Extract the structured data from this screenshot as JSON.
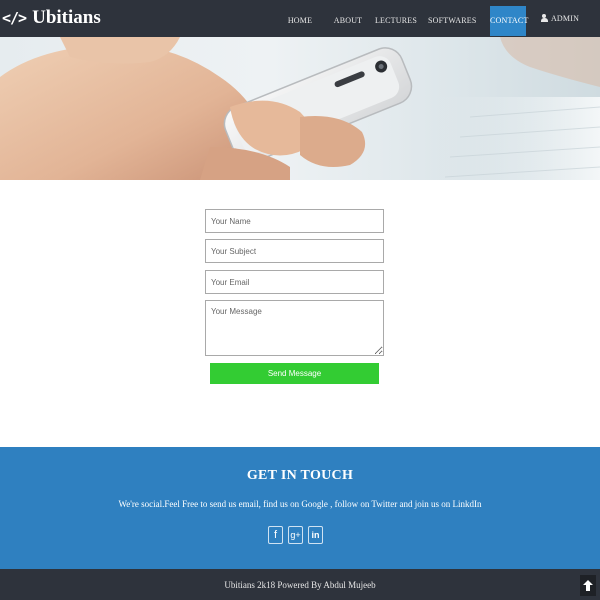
{
  "brand": {
    "icon": "</>",
    "name": "Ubitians"
  },
  "nav": {
    "items": [
      {
        "label": "HOME"
      },
      {
        "label": "ABOUT"
      },
      {
        "label": "LECTURES"
      },
      {
        "label": "SOFTWARES"
      },
      {
        "label": "CONTACT",
        "active": true
      },
      {
        "label": "ADMIN",
        "icon": "user-icon"
      }
    ]
  },
  "hero": {
    "image": "hand holding smartphone near laptop keyboard"
  },
  "form": {
    "name_placeholder": "Your Name",
    "subject_placeholder": "Your Subject",
    "email_placeholder": "Your Email",
    "message_placeholder": "Your Message",
    "send_label": "Send Message"
  },
  "touch": {
    "title": "GET IN TOUCH",
    "text": "We're social.Feel Free to send us email, find us on Google , follow on Twitter and join us on LinkdIn",
    "socials": [
      {
        "icon": "facebook-icon",
        "glyph": "f"
      },
      {
        "icon": "google-plus-icon",
        "glyph": "g+"
      },
      {
        "icon": "linkedin-icon",
        "glyph": "in"
      }
    ]
  },
  "footer": {
    "text": "Ubitians 2k18 Powered By Abdul Mujeeb",
    "top_icon": "arrow-up-icon"
  },
  "colors": {
    "navbar": "#2e333c",
    "active_nav": "#2f86c8",
    "send_button": "#33cc33",
    "contact_section": "#2f80c0",
    "footer": "#2e333c"
  }
}
